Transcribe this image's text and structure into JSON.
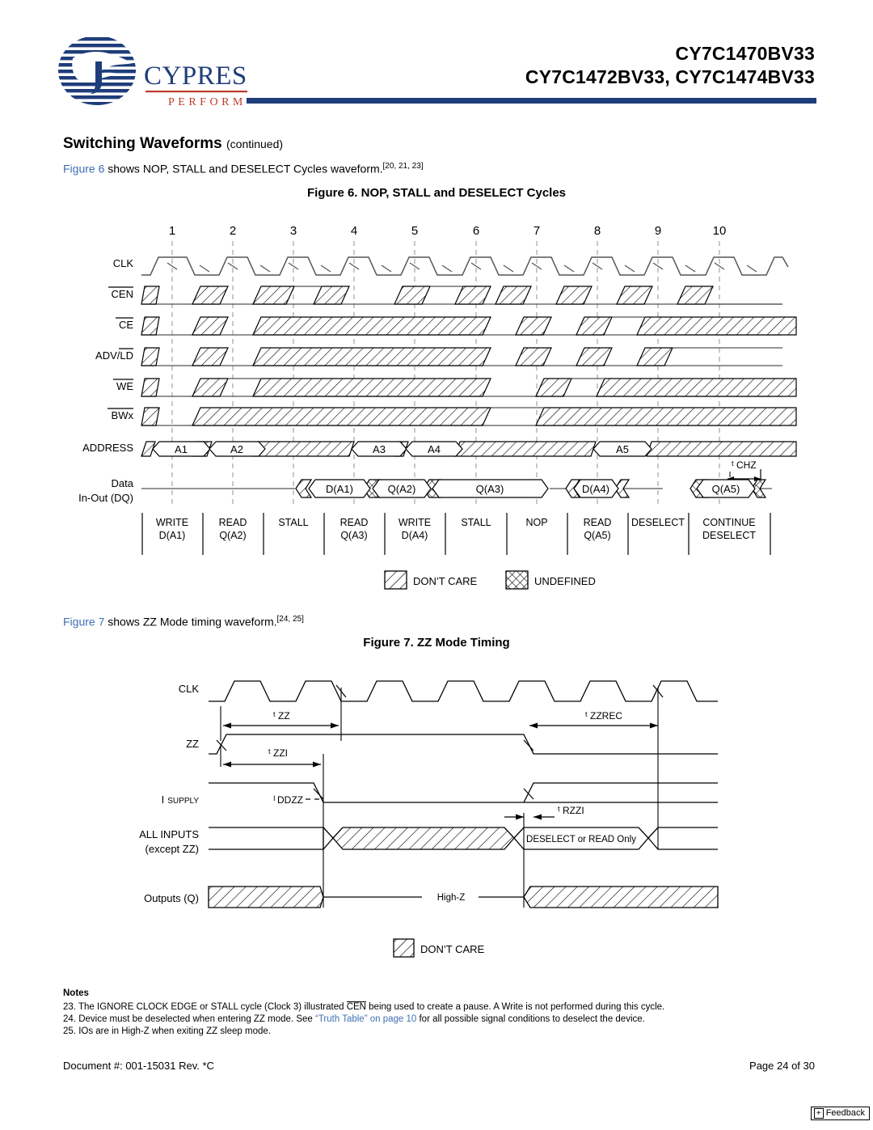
{
  "header": {
    "logo_text": "CYPRESS",
    "logo_tagline": "PERFORM",
    "part_line1": "CY7C1470BV33",
    "part_line2": "CY7C1472BV33, CY7C1474BV33"
  },
  "section": {
    "title": "Switching Waveforms",
    "continued": "(continued)"
  },
  "figure6": {
    "intro_link": "Figure 6",
    "intro_text": " shows NOP, STALL and DESELECT Cycles waveform.",
    "intro_refs": "[20, 21, 23]",
    "caption": "Figure 6.  NOP, STALL and DESELECT Cycles",
    "clock_numbers": [
      "1",
      "2",
      "3",
      "4",
      "5",
      "6",
      "7",
      "8",
      "9",
      "10"
    ],
    "signals": [
      {
        "name": "CLK",
        "overbar": false
      },
      {
        "name": "CEN",
        "overbar": true
      },
      {
        "name": "CE",
        "overbar": true
      },
      {
        "name": "ADV/LD",
        "overbar": "partial"
      },
      {
        "name": "WE",
        "overbar": true
      },
      {
        "name": "BWx",
        "overbar": true
      },
      {
        "name": "ADDRESS",
        "overbar": false
      }
    ],
    "data_label_line1": "Data",
    "data_label_line2": "In-Out  (DQ)",
    "address_values": [
      "A1",
      "A2",
      "A3",
      "A4",
      "A5"
    ],
    "data_values": [
      "D(A1)",
      "Q(A2)",
      "Q(A3)",
      "D(A4)",
      "Q(A5)"
    ],
    "timing_marker": "tCHZ",
    "timing_marker_sub": "CHZ",
    "cycle_labels": [
      {
        "l1": "WRITE",
        "l2": "D(A1)"
      },
      {
        "l1": "READ",
        "l2": "Q(A2)"
      },
      {
        "l1": "STALL",
        "l2": ""
      },
      {
        "l1": "READ",
        "l2": "Q(A3)"
      },
      {
        "l1": "WRITE",
        "l2": "D(A4)"
      },
      {
        "l1": "STALL",
        "l2": ""
      },
      {
        "l1": "NOP",
        "l2": ""
      },
      {
        "l1": "READ",
        "l2": "Q(A5)"
      },
      {
        "l1": "DESELECT",
        "l2": ""
      },
      {
        "l1": "CONTINUE",
        "l2": "DESELECT"
      }
    ],
    "legend": [
      {
        "key": "dontcare",
        "label": "DON'T  CARE"
      },
      {
        "key": "undefined",
        "label": "UNDEFINED"
      }
    ]
  },
  "figure7": {
    "intro_link": "Figure 7",
    "intro_text": " shows ZZ Mode timing waveform.",
    "intro_refs": "[24, 25]",
    "caption": "Figure 7.  ZZ Mode Timing",
    "signals": [
      {
        "name": "CLK",
        "sub": ""
      },
      {
        "name": "ZZ",
        "sub": ""
      },
      {
        "name": "I",
        "sub": "SUPPLY"
      },
      {
        "name": "ALL  INPUTS",
        "sub": "(except ZZ)"
      },
      {
        "name": "Outputs  (Q)",
        "sub": ""
      }
    ],
    "timings": [
      {
        "main": "t",
        "sub": "ZZ"
      },
      {
        "main": "t",
        "sub": "ZZREC"
      },
      {
        "main": "t",
        "sub": "ZZI"
      },
      {
        "main": "t",
        "sub": "RZZI"
      },
      {
        "main": "I",
        "sub": "DDZZ"
      }
    ],
    "inputs_annotation": "DESELECT  or  READ  Only",
    "outputs_annotation": "High-Z",
    "legend": [
      {
        "key": "dontcare",
        "label": "DON'T  CARE"
      }
    ]
  },
  "notes": {
    "heading": "Notes",
    "items": [
      {
        "num": "23.",
        "pre": "The IGNORE CLOCK EDGE or STALL cycle (Clock 3) illustrated ",
        "ovl": "CEN",
        "post": " being used to create a pause. A Write is not performed during this cycle."
      },
      {
        "num": "24.",
        "pre": "Device must be deselected when entering ZZ mode. See ",
        "link": "“Truth Table” on page 10",
        "post": " for all possible signal conditions to deselect the device."
      },
      {
        "num": "25.",
        "pre": "IOs are in High-Z when exiting ZZ sleep mode.",
        "post": ""
      }
    ]
  },
  "footer": {
    "document": "Document #: 001-15031 Rev. *C",
    "page": "Page 24 of 30",
    "feedback_plus": "+",
    "feedback_label": "Feedback"
  },
  "colors": {
    "brand_blue": "#1f3d7a",
    "link_blue": "#3f6fb5",
    "grid_gray": "#999999"
  }
}
